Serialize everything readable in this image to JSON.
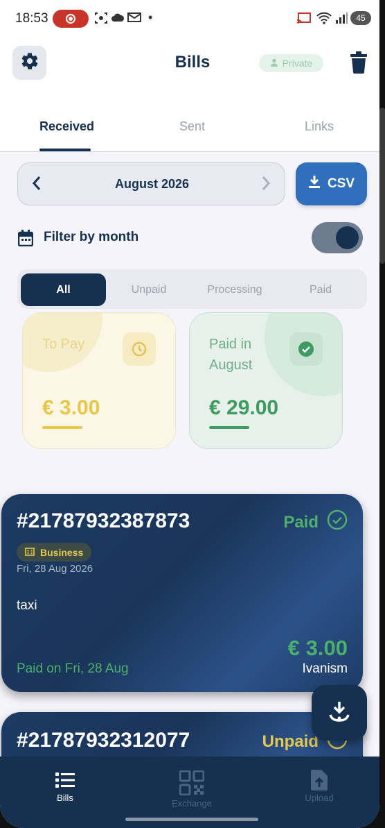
{
  "status_bar": {
    "time": "18:53",
    "battery": "45"
  },
  "header": {
    "title": "Bills",
    "badge": "Private"
  },
  "tabs": [
    {
      "label": "Received",
      "active": true
    },
    {
      "label": "Sent",
      "active": false
    },
    {
      "label": "Links",
      "active": false
    }
  ],
  "month_selector": {
    "label": "August 2026",
    "csv_label": "CSV"
  },
  "filter": {
    "label": "Filter by month",
    "enabled": true
  },
  "segments": [
    {
      "label": "All",
      "active": true
    },
    {
      "label": "Unpaid",
      "active": false
    },
    {
      "label": "Processing",
      "active": false
    },
    {
      "label": "Paid",
      "active": false
    }
  ],
  "summary": {
    "to_pay": {
      "title": "To Pay",
      "amount": "€ 3.00",
      "color": "#e8c84a",
      "icon": "clock-icon"
    },
    "paid": {
      "title_line1": "Paid in",
      "title_line2": "August",
      "amount": "€ 29.00",
      "color": "#3f9b5f",
      "icon": "check-circle-icon"
    }
  },
  "bills": [
    {
      "number": "#21787932387873",
      "status": "Paid",
      "status_color": "#4caf6c",
      "category": "Business",
      "date": "Fri, 28 Aug 2026",
      "description": "taxi",
      "amount": "€ 3.00",
      "payer": "Ivanism",
      "paid_on": "Paid on Fri, 28 Aug"
    },
    {
      "number": "#21787932312077",
      "status": "Unpaid",
      "status_color": "#e4c74f"
    }
  ],
  "bottom_nav": [
    {
      "label": "Bills",
      "icon": "list-icon",
      "active": true
    },
    {
      "label": "Exchange",
      "icon": "qr-code-icon",
      "active": false
    },
    {
      "label": "Upload",
      "icon": "upload-file-icon",
      "active": false
    }
  ],
  "colors": {
    "primary": "#16304f",
    "accent_blue": "#2f6fbb",
    "green": "#4caf6c",
    "yellow": "#e4c74f"
  }
}
